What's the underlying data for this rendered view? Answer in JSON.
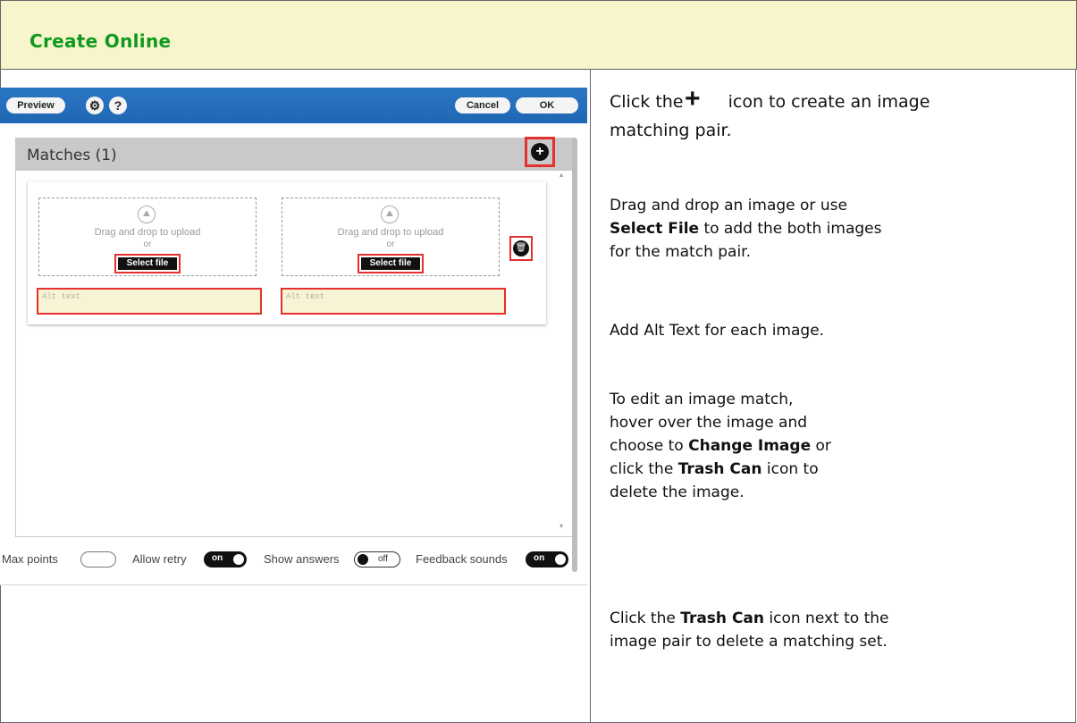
{
  "header": {
    "title": "Create Online"
  },
  "editor": {
    "toolbar": {
      "preview_label": "Preview",
      "settings_icon": "gear-icon",
      "help_label": "?",
      "cancel_label": "Cancel",
      "ok_label": "OK"
    },
    "matches_title": "Matches (1)",
    "add_icon": "plus-icon",
    "drop_text": "Drag and drop to upload",
    "drop_or": "or",
    "select_file_label": "Select file",
    "alt_placeholder": "Alt text",
    "delete_icon": "trash-icon",
    "footer": {
      "max_points_label": "Max points",
      "allow_retry_label": "Allow retry",
      "allow_retry_state": "on",
      "show_answers_label": "Show answers",
      "show_answers_state": "off",
      "feedback_sounds_label": "Feedback sounds",
      "feedback_sounds_state": "on"
    }
  },
  "instructions": {
    "step1_a": "Click the",
    "step1_b": "icon to create an image",
    "step1_c": "matching pair.",
    "step2_a": "Drag and drop an image or use",
    "step2_b_bold": "Select File",
    "step2_b": " to add the both images",
    "step2_c": "for the match pair.",
    "step3": "Add Alt Text for each image.",
    "step4_a": "To edit an image match,",
    "step4_b": "hover over the image and",
    "step4_c": "choose to ",
    "step4_c_bold": "Change Image",
    "step4_c_end": " or",
    "step4_d": "click the ",
    "step4_d_bold": "Trash Can",
    "step4_d_end": " icon to",
    "step4_e": "delete the image.",
    "step5_a": "Click the ",
    "step5_a_bold": "Trash Can",
    "step5_a_end": " icon next to the",
    "step5_b": "image pair to delete a matching set."
  }
}
